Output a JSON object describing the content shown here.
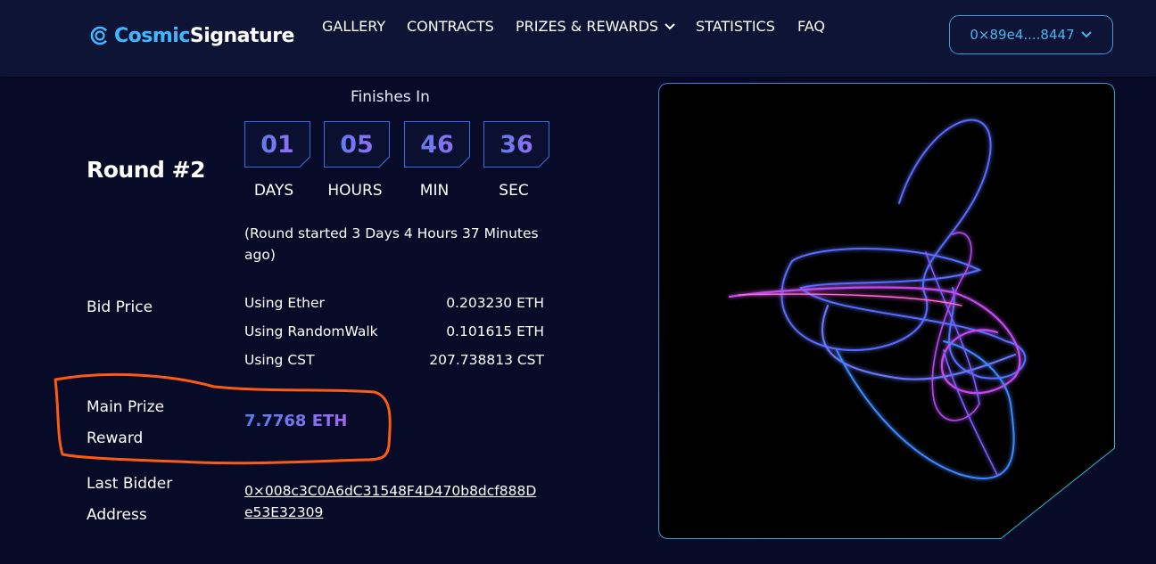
{
  "header": {
    "logo": {
      "part1": "Cosmic",
      "part2": "Signature"
    },
    "nav": [
      {
        "label": "GALLERY"
      },
      {
        "label": "CONTRACTS"
      },
      {
        "label": "PRIZES & REWARDS"
      },
      {
        "label": "STATISTICS"
      },
      {
        "label": "FAQ"
      }
    ],
    "wallet_address": "0×89e4....8447"
  },
  "round": {
    "title": "Round #2",
    "finishes_label": "Finishes In",
    "countdown": [
      {
        "value": "01",
        "unit": "DAYS"
      },
      {
        "value": "05",
        "unit": "HOURS"
      },
      {
        "value": "46",
        "unit": "MIN"
      },
      {
        "value": "36",
        "unit": "SEC"
      }
    ],
    "started_text": "(Round started 3 Days 4 Hours 37 Minutes ago)"
  },
  "bid_price": {
    "label": "Bid Price",
    "rows": [
      {
        "method": "Using Ether",
        "value": "0.203230 ETH"
      },
      {
        "method": "Using RandomWalk",
        "value": "0.101615 ETH"
      },
      {
        "method": "Using CST",
        "value": "207.738813 CST"
      }
    ]
  },
  "main_prize": {
    "label_line1": "Main Prize",
    "label_line2": "Reward",
    "value": "7.7768 ETH"
  },
  "last_bidder": {
    "label_line1": "Last Bidder",
    "label_line2": "Address",
    "address": "0×008c3C0A6dC31548F4D470b8dcf888De53E32309"
  },
  "colors": {
    "background": "#080b28",
    "header": "#0e1436",
    "accent_blue": "#4d82f0",
    "accent_purple": "#a469f0",
    "annotation": "#ff5a14"
  }
}
